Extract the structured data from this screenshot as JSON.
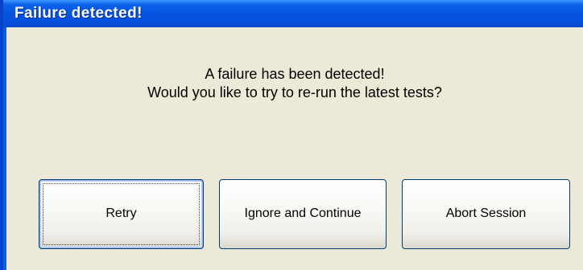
{
  "window": {
    "title": "Failure detected!"
  },
  "message": {
    "line1": "A failure has been detected!",
    "line2": "Would you like to try to re-run the latest tests?"
  },
  "buttons": {
    "retry": "Retry",
    "ignore": "Ignore and Continue",
    "abort": "Abort Session"
  },
  "colors": {
    "titlebar": "#0453e0",
    "client": "#ece9d8",
    "button_border": "#003c74"
  }
}
